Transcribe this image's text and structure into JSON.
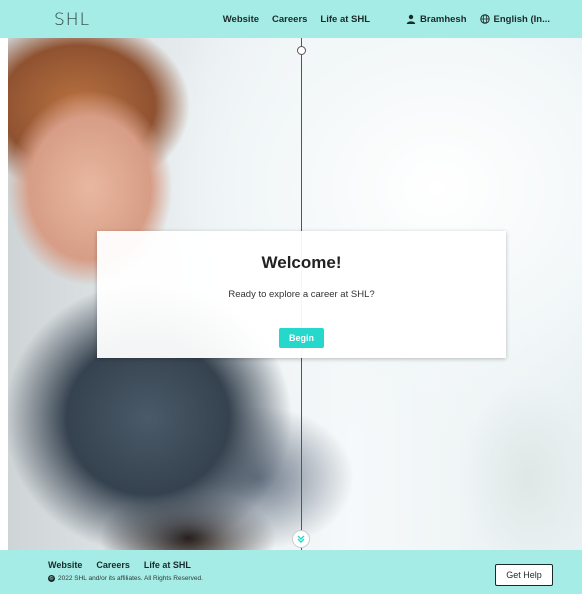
{
  "header": {
    "logo": "SHL",
    "nav": {
      "website": "Website",
      "careers": "Careers",
      "life": "Life at SHL",
      "user": "Bramhesh",
      "language": "English (In..."
    },
    "icons": {
      "user": "user-icon",
      "language": "globe-icon"
    }
  },
  "welcome": {
    "title": "Welcome!",
    "subtitle": "Ready to explore a career at SHL?",
    "begin_label": "Begin"
  },
  "hero": {
    "scroll_icon": "chevron-double-down-icon"
  },
  "footer": {
    "links": [
      "Website",
      "Careers",
      "Life at SHL"
    ],
    "copyright": "2022 SHL and/or its affiliates. All Rights Reserved.",
    "copyright_symbol": "©",
    "help_label": "Get Help"
  },
  "colors": {
    "brand_bar": "#a6ece6",
    "accent": "#26d7cb"
  }
}
